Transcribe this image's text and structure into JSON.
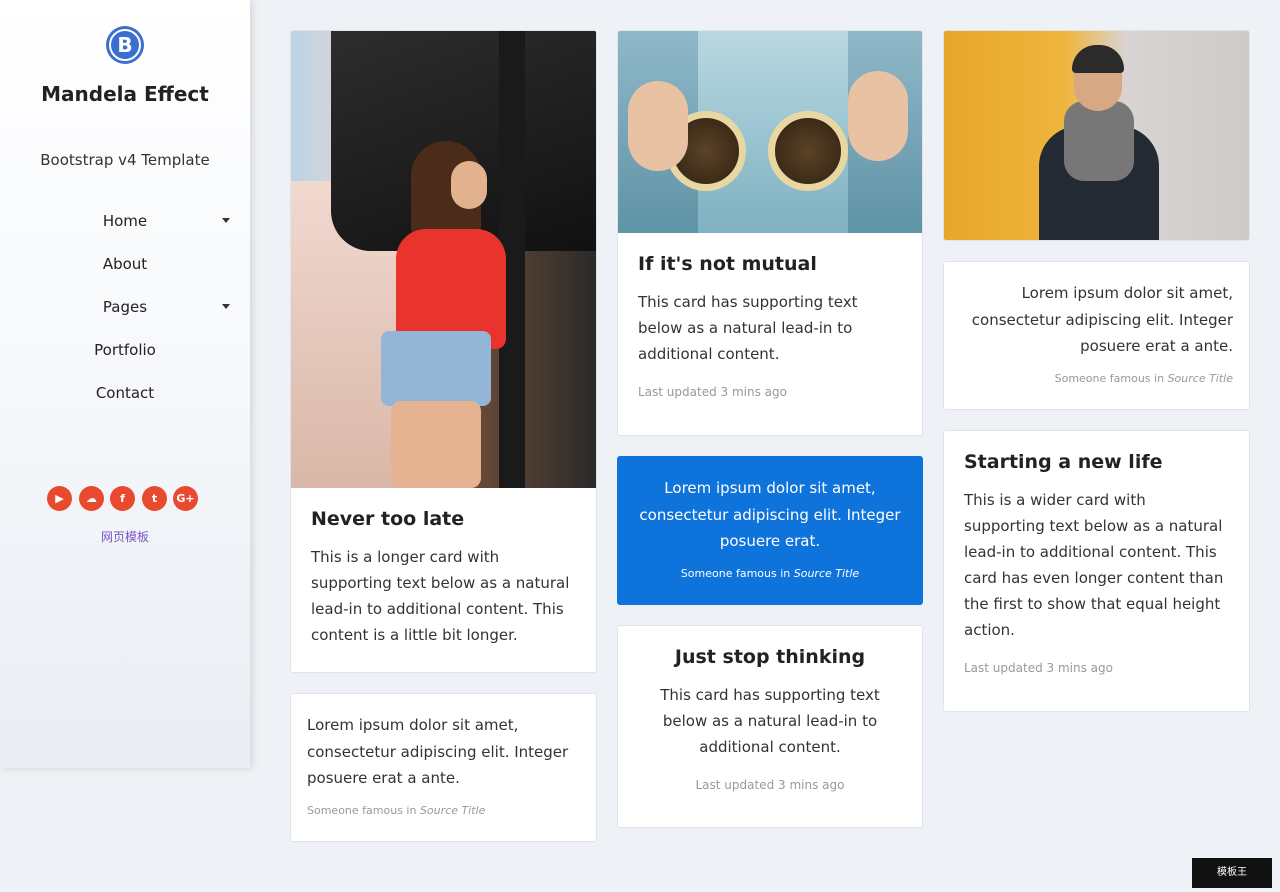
{
  "sidebar": {
    "logo_letter": "B",
    "brand": "Mandela Effect",
    "tagline": "Bootstrap v4 Template",
    "nav": [
      {
        "label": "Home",
        "dropdown": true
      },
      {
        "label": "About",
        "dropdown": false
      },
      {
        "label": "Pages",
        "dropdown": true
      },
      {
        "label": "Portfolio",
        "dropdown": false
      },
      {
        "label": "Contact",
        "dropdown": false
      }
    ],
    "social": [
      {
        "icon": "youtube-icon",
        "glyph": "▶"
      },
      {
        "icon": "soundcloud-icon",
        "glyph": "☁"
      },
      {
        "icon": "facebook-icon",
        "glyph": "f"
      },
      {
        "icon": "twitter-icon",
        "glyph": "t"
      },
      {
        "icon": "google-plus-icon",
        "glyph": "G+"
      }
    ],
    "footer_link": "网页模板",
    "social_color": "#e94a2f"
  },
  "cards": {
    "never_too_late": {
      "title": "Never too late",
      "text": "This is a longer card with supporting text below as a natural lead-in to additional content. This content is a little bit longer."
    },
    "quote_left": {
      "text": "Lorem ipsum dolor sit amet, consectetur adipiscing elit. Integer posuere erat a ante.",
      "footer_prefix": "Someone famous in",
      "footer_source": "Source Title"
    },
    "not_mutual": {
      "title": "If it's not mutual",
      "text": "This card has supporting text below as a natural lead-in to additional content.",
      "muted": "Last updated 3 mins ago"
    },
    "quote_blue": {
      "text": "Lorem ipsum dolor sit amet, consectetur adipiscing elit. Integer posuere erat.",
      "footer_prefix": "Someone famous in",
      "footer_source": "Source Title",
      "color": "#0f73dc"
    },
    "stop_thinking": {
      "title": "Just stop thinking",
      "text": "This card has supporting text below as a natural lead-in to additional content.",
      "muted": "Last updated 3 mins ago"
    },
    "quote_right": {
      "text": "Lorem ipsum dolor sit amet, consectetur adipiscing elit. Integer posuere erat a ante.",
      "footer_prefix": "Someone famous in",
      "footer_source": "Source Title"
    },
    "new_life": {
      "title": "Starting a new life",
      "text": "This is a wider card with supporting text below as a natural lead-in to additional content. This card has even longer content than the first to show that equal height action.",
      "muted": "Last updated 3 mins ago"
    }
  },
  "watermark": "模板王"
}
